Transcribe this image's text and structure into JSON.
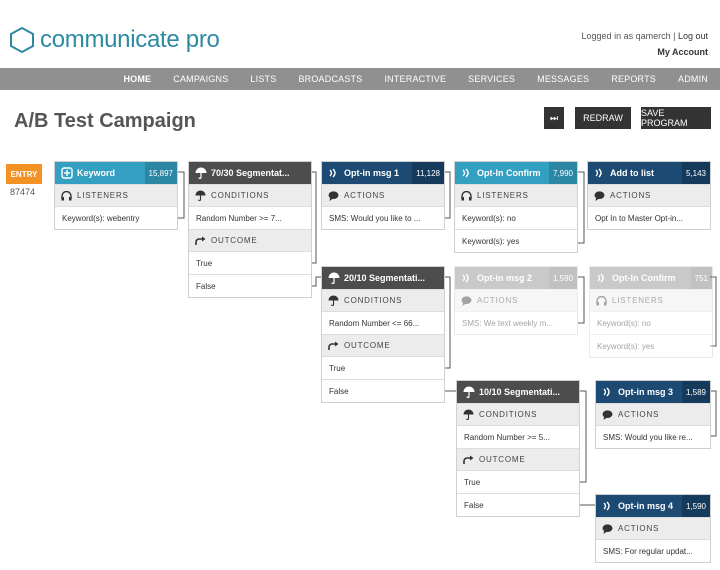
{
  "header": {
    "logo_text": "communicate pro",
    "logged_in": "Logged in as qamerch",
    "logout": "Log out",
    "my_account": "My Account"
  },
  "nav": [
    "HOME",
    "CAMPAIGNS",
    "LISTS",
    "BROADCASTS",
    "INTERACTIVE",
    "SERVICES",
    "MESSAGES",
    "REPORTS",
    "ADMIN"
  ],
  "page_title": "A/B Test Campaign",
  "buttons": {
    "skip": "⏭",
    "redraw": "REDRAW",
    "save": "SAVE PROGRAM"
  },
  "entry": {
    "label": "ENTRY",
    "code": "87474"
  },
  "colors": {
    "teal": "#34a0c1",
    "dark": "#4d4d4d",
    "navy": "#1c4a72",
    "orange": "#f39224",
    "nav_bar": "#909090"
  },
  "cards": {
    "keyword": {
      "title": "Keyword",
      "count": "15,897",
      "section": "LISTENERS",
      "rows": [
        "Keyword(s): webentry"
      ]
    },
    "seg1": {
      "title": "70/30 Segmentat...",
      "conditions": "CONDITIONS",
      "cond_row": "Random Number >= 7...",
      "outcome": "OUTCOME",
      "true": "True",
      "false": "False"
    },
    "optin1": {
      "title": "Opt-in msg 1",
      "count": "11,128",
      "section": "ACTIONS",
      "rows": [
        "SMS: Would you like to ..."
      ]
    },
    "confirm1": {
      "title": "Opt-In Confirm",
      "count": "7,990",
      "section": "LISTENERS",
      "rows": [
        "Keyword(s): no",
        "Keyword(s): yes"
      ]
    },
    "addlist": {
      "title": "Add to list",
      "count": "5,143",
      "section": "ACTIONS",
      "rows": [
        "Opt In to Master Opt-in..."
      ]
    },
    "seg2": {
      "title": "20/10 Segmentati...",
      "conditions": "CONDITIONS",
      "cond_row": "Random Number <= 66...",
      "outcome": "OUTCOME",
      "true": "True",
      "false": "False"
    },
    "optin2": {
      "title": "Opt-in msg 2",
      "count": "1,590",
      "section": "ACTIONS",
      "rows": [
        "SMS: We text weekly m..."
      ]
    },
    "confirm2": {
      "title": "Opt-In Confirm",
      "count": "751",
      "section": "LISTENERS",
      "rows": [
        "Keyword(s): no",
        "Keyword(s): yes"
      ]
    },
    "seg3": {
      "title": "10/10 Segmentati...",
      "conditions": "CONDITIONS",
      "cond_row": "Random Number >= 5...",
      "outcome": "OUTCOME",
      "true": "True",
      "false": "False"
    },
    "optin3": {
      "title": "Opt-in msg 3",
      "count": "1,589",
      "section": "ACTIONS",
      "rows": [
        "SMS: Would you like re..."
      ]
    },
    "optin4": {
      "title": "Opt-in msg 4",
      "count": "1,590",
      "section": "ACTIONS",
      "rows": [
        "SMS: For regular updat..."
      ]
    }
  }
}
